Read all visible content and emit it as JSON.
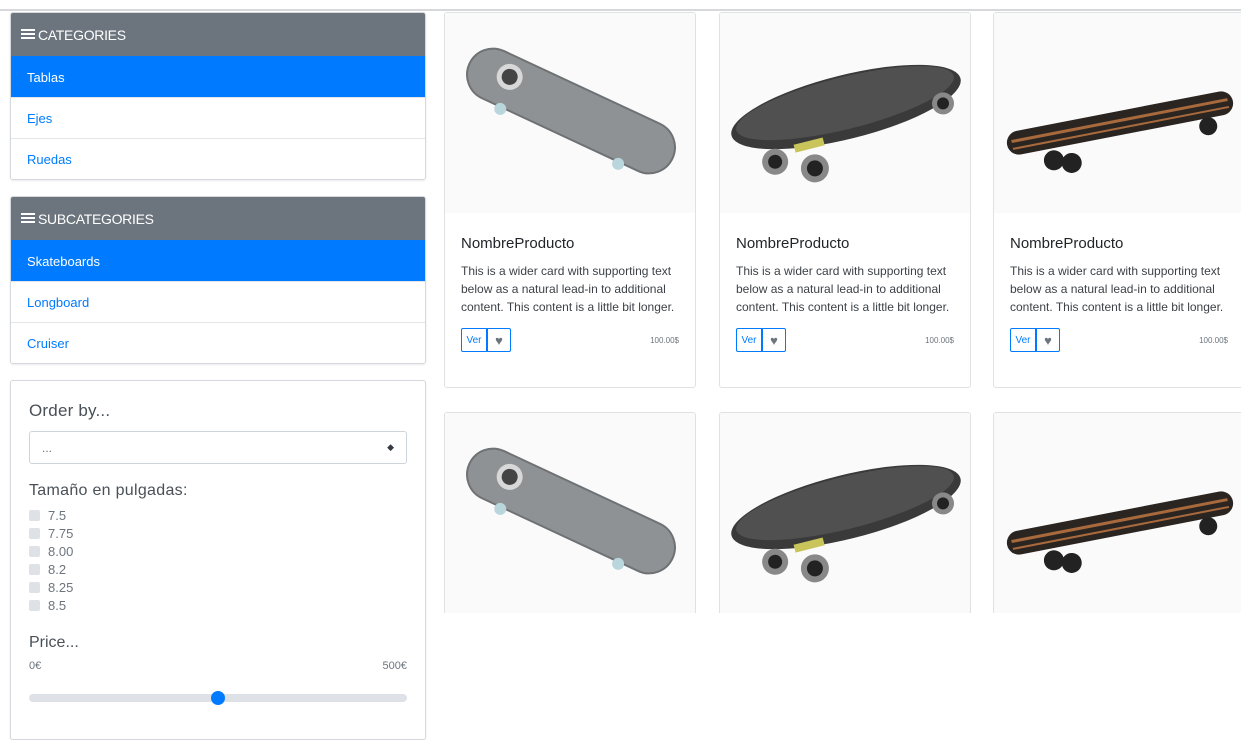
{
  "categories": {
    "header": "CATEGORIES",
    "header_icon": "list-icon",
    "items": [
      {
        "label": "Tablas",
        "active": true
      },
      {
        "label": "Ejes",
        "active": false
      },
      {
        "label": "Ruedas",
        "active": false
      }
    ]
  },
  "subcategories": {
    "header": "SUBCATEGORIES",
    "header_icon": "list-icon",
    "items": [
      {
        "label": "Skateboards",
        "active": true
      },
      {
        "label": "Longboard",
        "active": false
      },
      {
        "label": "Cruiser",
        "active": false
      }
    ]
  },
  "filters": {
    "order_title": "Order by...",
    "order_value": "...",
    "size_title": "Tamaño en pulgadas:",
    "sizes": [
      "7.5",
      "7.75",
      "8.00",
      "8.2",
      "8.25",
      "8.5"
    ],
    "price_title": "Price...",
    "price_min": "0€",
    "price_max": "500€",
    "price_slider_value_fraction": 0.5
  },
  "products": [
    {
      "name": "NombreProducto",
      "description": "This is a wider card with supporting text below as a natural lead-in to additional content. This content is a little bit longer.",
      "view_label": "Ver",
      "price": "100.00$",
      "image": "skateboard"
    },
    {
      "name": "NombreProducto",
      "description": "This is a wider card with supporting text below as a natural lead-in to additional content. This content is a little bit longer.",
      "view_label": "Ver",
      "price": "100.00$",
      "image": "cruiser"
    },
    {
      "name": "NombreProducto",
      "description": "This is a wider card with supporting text below as a natural lead-in to additional content. This content is a little bit longer.",
      "view_label": "Ver",
      "price": "100.00$",
      "image": "longboard"
    },
    {
      "name": "",
      "description": "",
      "view_label": "",
      "price": "",
      "image": "skateboard"
    },
    {
      "name": "",
      "description": "",
      "view_label": "",
      "price": "",
      "image": "cruiser"
    },
    {
      "name": "",
      "description": "",
      "view_label": "",
      "price": "",
      "image": "longboard"
    }
  ],
  "colors": {
    "primary": "#007bff",
    "header_bg": "#6c757d"
  }
}
